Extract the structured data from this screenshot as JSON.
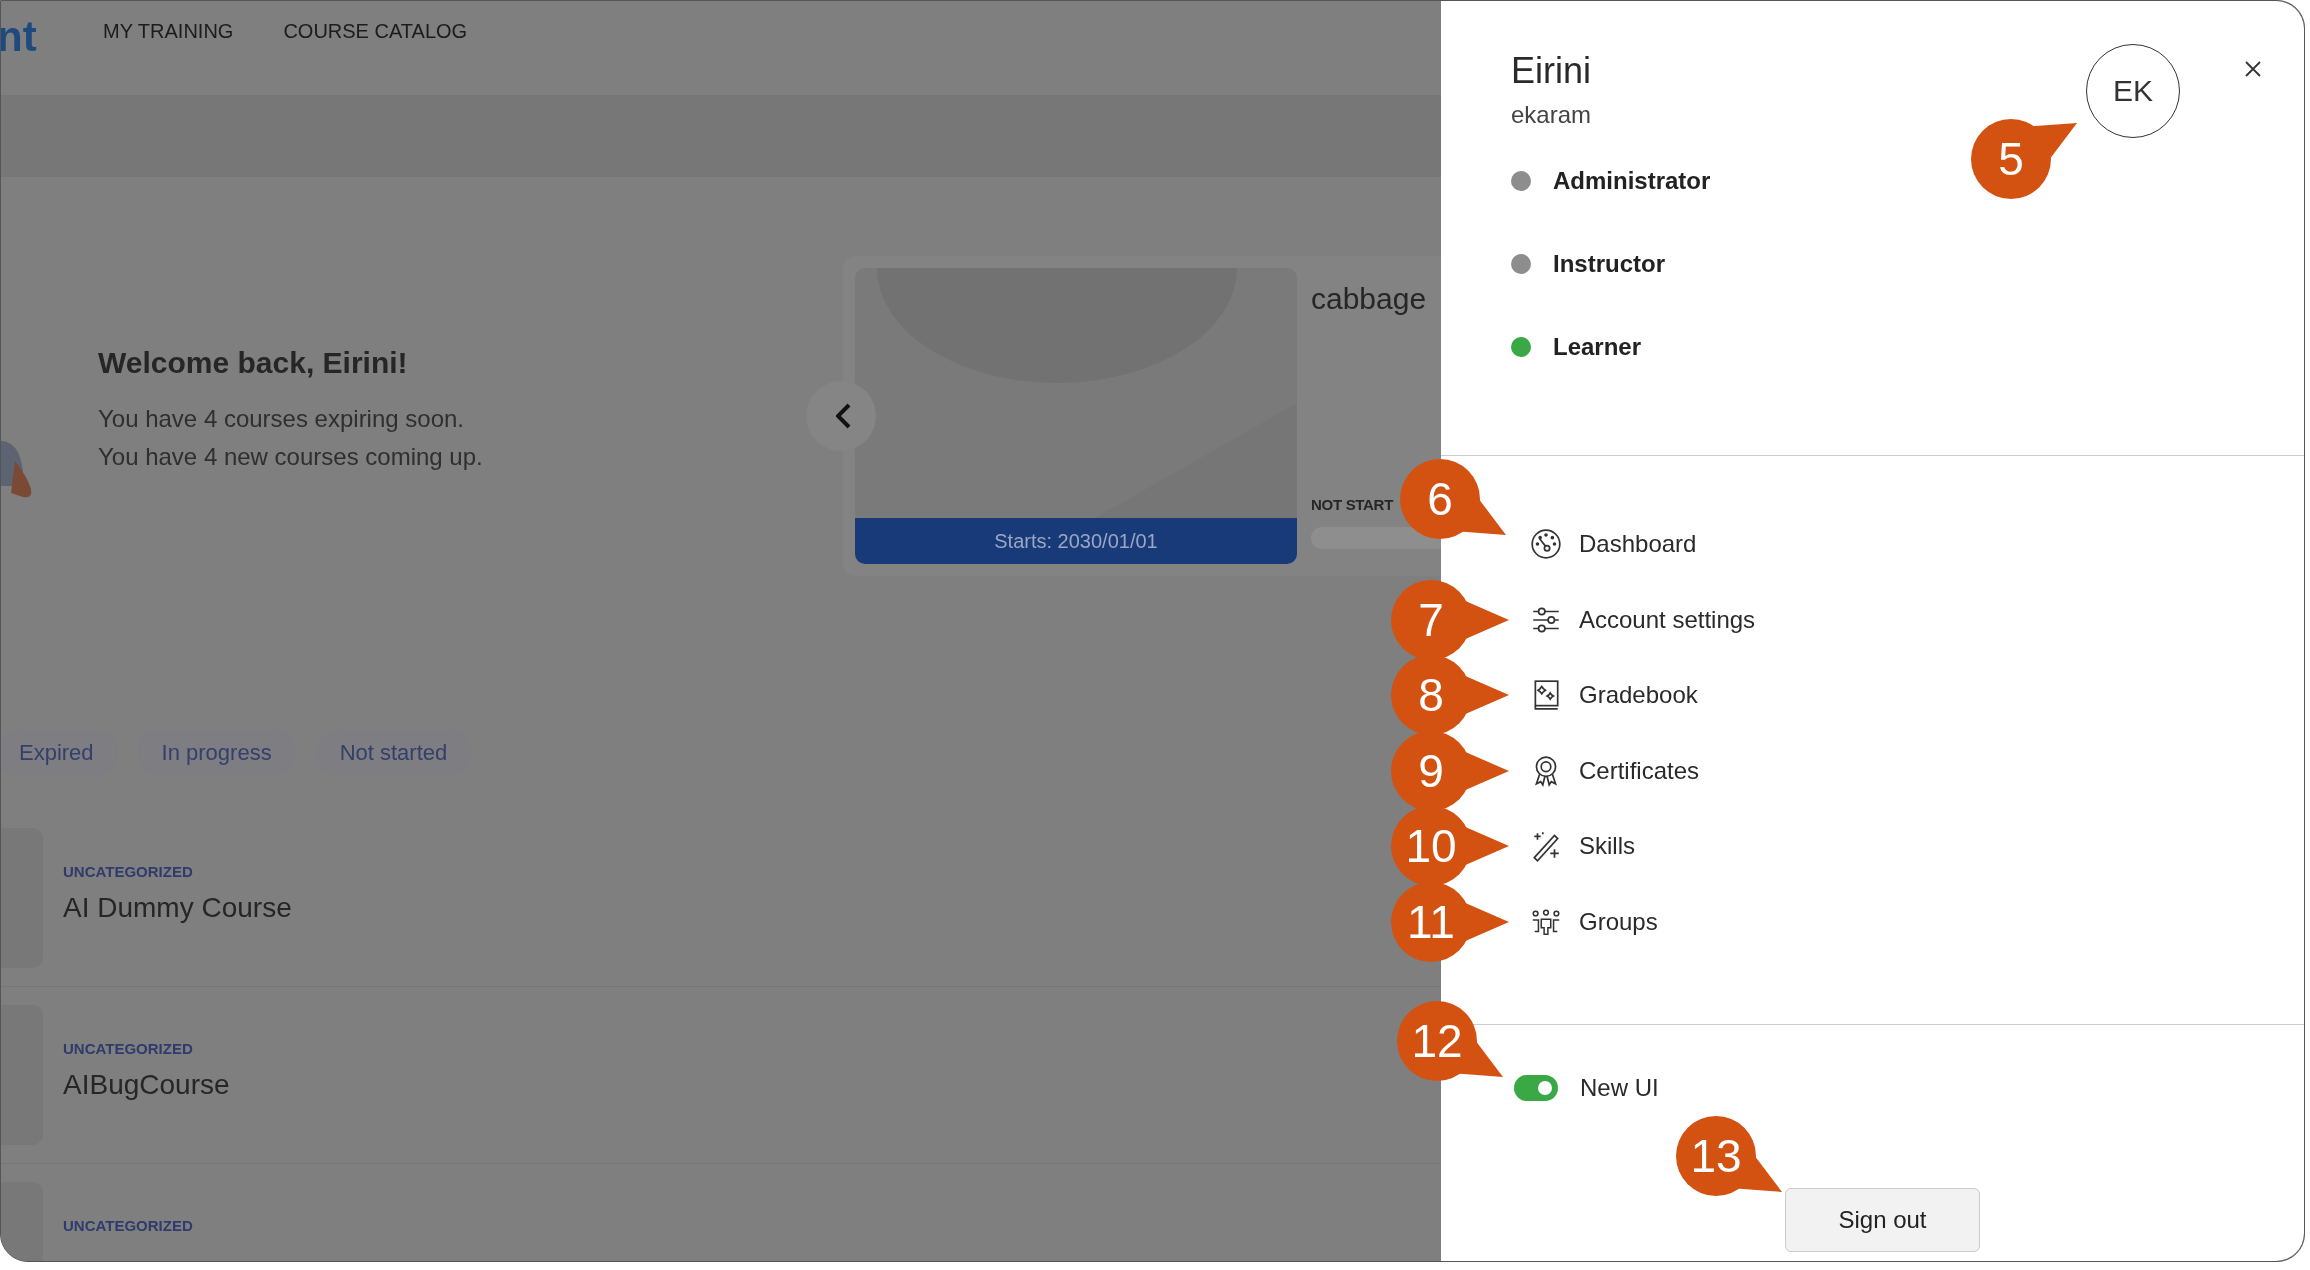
{
  "nav": {
    "logo_text": "nt",
    "items": [
      "MY TRAINING",
      "COURSE CATALOG"
    ]
  },
  "welcome": {
    "heading": "Welcome back, Eirini!",
    "lines": [
      "You have 4 courses expiring soon.",
      "You have 4 new courses coming up."
    ]
  },
  "featured_course": {
    "start_label": "Starts: 2030/01/01",
    "title": "cabbage",
    "status": "NOT START"
  },
  "filters": [
    "Expired",
    "In progress",
    "Not started"
  ],
  "courses": [
    {
      "category": "UNCATEGORIZED",
      "title": "AI Dummy Course"
    },
    {
      "category": "UNCATEGORIZED",
      "title": "AIBugCourse"
    },
    {
      "category": "UNCATEGORIZED"
    }
  ],
  "profile_panel": {
    "name": "Eirini",
    "username": "ekaram",
    "initials": "EK",
    "avatar_callout": {
      "number": "5"
    },
    "roles": [
      {
        "label": "Administrator",
        "active": false
      },
      {
        "label": "Instructor",
        "active": false
      },
      {
        "label": "Learner",
        "active": true
      }
    ],
    "menu": [
      {
        "label": "Dashboard",
        "callout": {
          "number": "6"
        }
      },
      {
        "label": "Account settings",
        "callout": {
          "number": "7"
        }
      },
      {
        "label": "Gradebook",
        "callout": {
          "number": "8"
        }
      },
      {
        "label": "Certificates",
        "callout": {
          "number": "9"
        }
      },
      {
        "label": "Skills",
        "callout": {
          "number": "10"
        }
      },
      {
        "label": "Groups",
        "callout": {
          "number": "11"
        }
      }
    ],
    "new_ui": {
      "label": "New UI",
      "on": true,
      "callout": {
        "number": "12"
      }
    },
    "sign_out": {
      "label": "Sign out",
      "callout": {
        "number": "13"
      }
    }
  }
}
